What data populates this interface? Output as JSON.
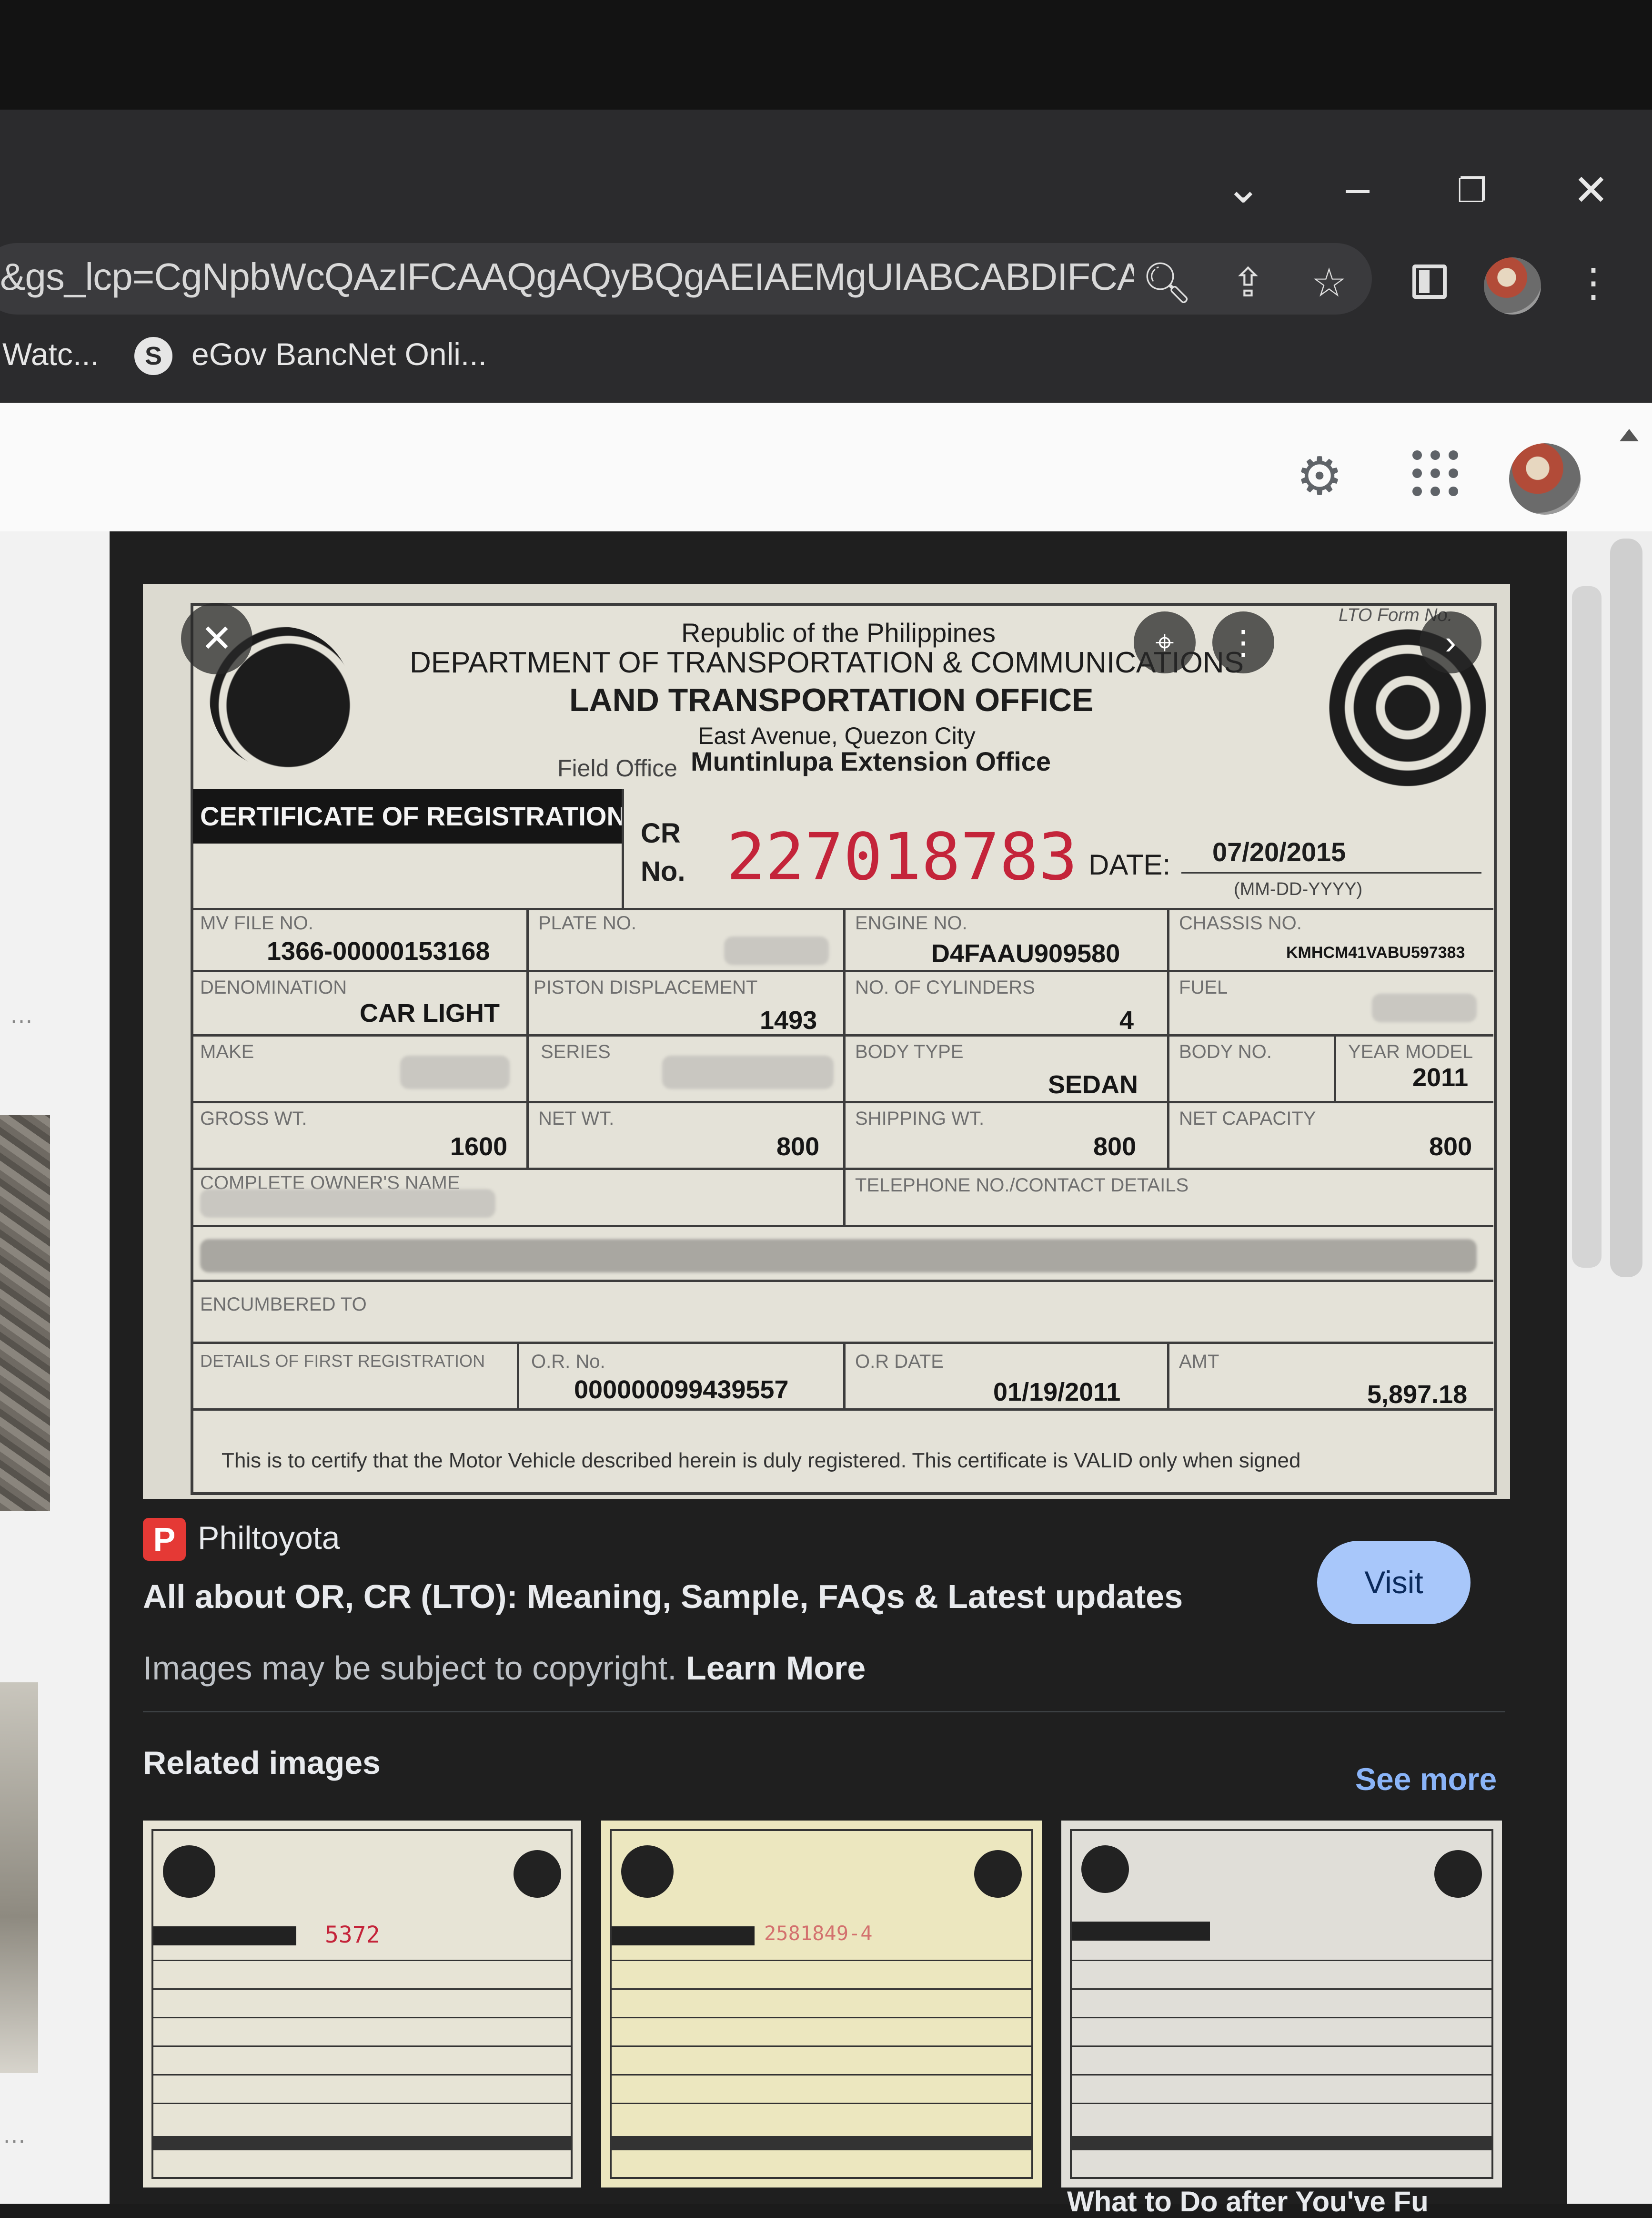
{
  "browser": {
    "url": "&gs_lcp=CgNpbWcQAzIFCAAQgAQyBQgAEIAEMgUIABCABDIFCAAQ...",
    "bookmarks": [
      {
        "label": "Watc..."
      },
      {
        "label": "eGov BancNet Onli..."
      }
    ]
  },
  "preview": {
    "source": "Philtoyota",
    "title": "All about OR, CR (LTO): Meaning, Sample, FAQs & Latest updates",
    "copyright": "Images may be subject to copyright.",
    "learn_more": "Learn More",
    "visit": "Visit",
    "related_heading": "Related images",
    "see_more": "See more",
    "bottom_cut": "What to Do after You've Fu"
  },
  "document": {
    "republic": "Republic of the Philippines",
    "department": "DEPARTMENT OF TRANSPORTATION & COMMUNICATIONS",
    "office": "LAND TRANSPORTATION OFFICE",
    "address": "East Avenue, Quezon City",
    "field_office_label": "Field Office",
    "field_office": "Muntinlupa Extension Office",
    "form_no": "LTO Form No.",
    "cert_title": "CERTIFICATE OF REGISTRATION",
    "cr_label_1": "CR",
    "cr_label_2": "No.",
    "cr_no": "227018783",
    "date_label": "DATE:",
    "date": "07/20/2015",
    "date_format": "(MM-DD-YYYY)",
    "mv_file_label": "MV FILE NO.",
    "mv_file": "1366-00000153168",
    "plate_label": "PLATE NO.",
    "engine_label": "ENGINE NO.",
    "engine": "D4FAAU909580",
    "chassis_label": "CHASSIS NO.",
    "chassis": "KMHCM41VABU597383",
    "denomination_label": "DENOMINATION",
    "denomination": "CAR LIGHT",
    "piston_label": "PISTON DISPLACEMENT",
    "piston": "1493",
    "cylinders_label": "NO. OF CYLINDERS",
    "cylinders": "4",
    "fuel_label": "FUEL",
    "make_label": "MAKE",
    "series_label": "SERIES",
    "body_type_label": "BODY TYPE",
    "body_type": "SEDAN",
    "body_no_label": "BODY NO.",
    "year_model_label": "YEAR MODEL",
    "year_model": "2011",
    "gross_label": "GROSS WT.",
    "gross": "1600",
    "net_label": "NET WT.",
    "net": "800",
    "shipping_label": "SHIPPING WT.",
    "shipping": "800",
    "net_capacity_label": "NET CAPACITY",
    "net_capacity": "800",
    "owner_label": "COMPLETE OWNER'S NAME",
    "telephone_label": "TELEPHONE NO./CONTACT DETAILS",
    "encumbered_label": "ENCUMBERED TO",
    "first_reg_label": "DETAILS OF FIRST REGISTRATION",
    "or_label": "O.R. No.",
    "or_no": "000000099439557",
    "or_date_label": "O.R DATE",
    "or_date": "01/19/2011",
    "amt_label": "AMT",
    "amt": "5,897.18",
    "certify": "This is to certify that the Motor Vehicle described herein is duly registered. This certificate is VALID only when signed"
  },
  "related": [
    {
      "cr": "5372"
    },
    {
      "cr": "2581849-4"
    },
    {
      "cr": ""
    }
  ],
  "colors": {
    "chrome": "#2b2b2d",
    "panel": "#1f1f1f",
    "visit_bg": "#a8c7fa",
    "link": "#8ab4f8",
    "cr_red": "#c4243a"
  }
}
